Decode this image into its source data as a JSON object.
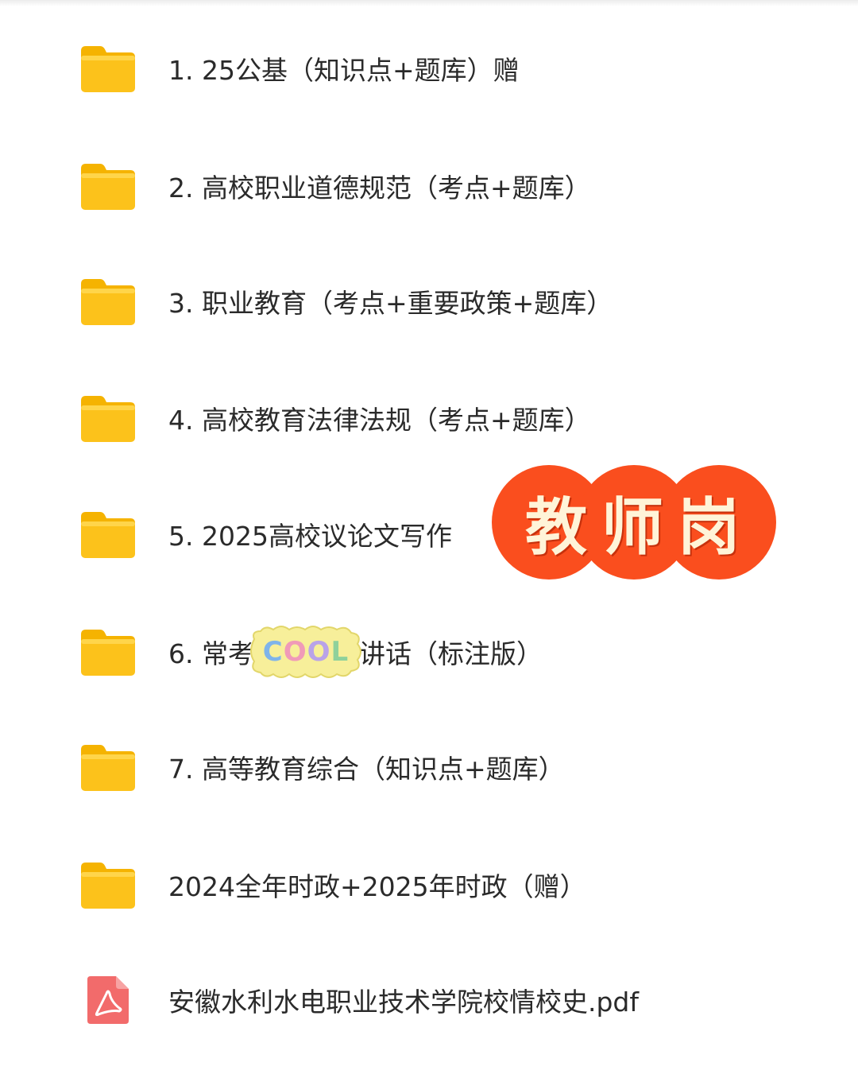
{
  "files": [
    {
      "type": "folder",
      "icon": "folder-icon",
      "name": "1. 25公基（知识点+题库）赠"
    },
    {
      "type": "folder",
      "icon": "folder-icon",
      "name": "2. 高校职业道德规范（考点+题库）"
    },
    {
      "type": "folder",
      "icon": "folder-icon",
      "name": "3. 职业教育（考点+重要政策+题库）"
    },
    {
      "type": "folder",
      "icon": "folder-icon",
      "name": "4. 高校教育法律法规（考点+题库）"
    },
    {
      "type": "folder",
      "icon": "folder-icon",
      "name": "5. 2025高校议论文写作"
    },
    {
      "type": "folder",
      "icon": "folder-icon",
      "name": "6. 常考高等教育讲话（标注版）"
    },
    {
      "type": "folder",
      "icon": "folder-icon",
      "name": "7. 高等教育综合（知识点+题库）"
    },
    {
      "type": "folder",
      "icon": "folder-icon",
      "name": "2024全年时政+2025年时政（赠）"
    },
    {
      "type": "pdf",
      "icon": "pdf-icon",
      "name": "安徽水利水电职业技术学院校情校史.pdf"
    }
  ],
  "stamp": {
    "text": "教师岗",
    "color": "#fa4e1e"
  },
  "sticker": {
    "text": "COOL",
    "letters": [
      "C",
      "O",
      "O",
      "L"
    ]
  },
  "colors": {
    "folder": "#fcc21b",
    "pdf": "#f26b6b",
    "text": "#2a2a2a"
  }
}
